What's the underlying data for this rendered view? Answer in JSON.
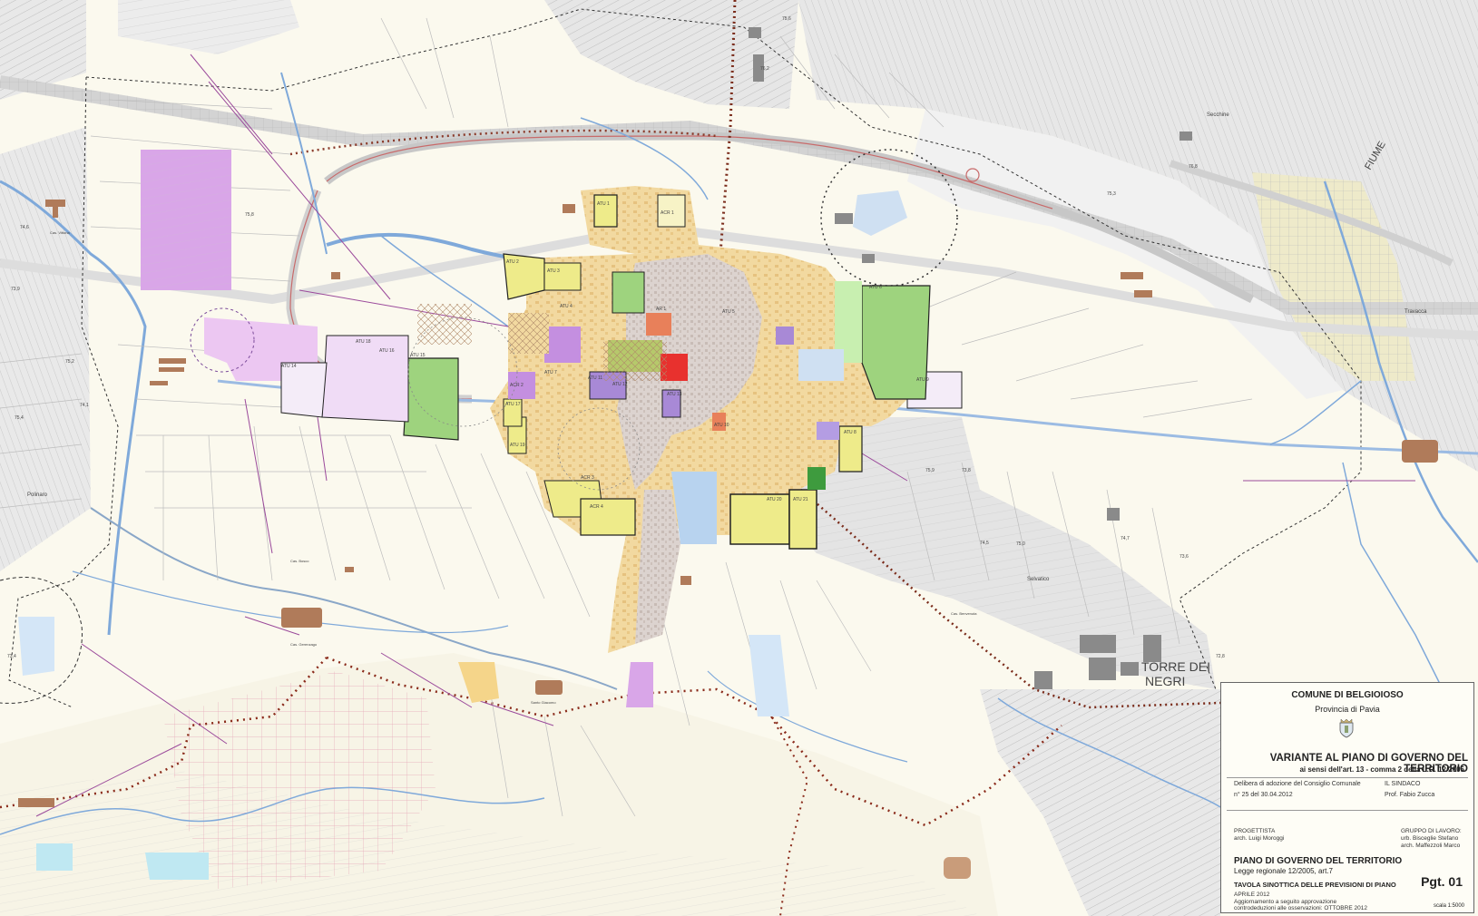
{
  "map": {
    "place_labels": [
      "TORRE DEI",
      "NEGRI",
      "FIUME",
      "Travacca",
      "Secchine",
      "Polinaro",
      "Selvatico",
      "Cas. Vittoria",
      "Cas. Gerenzago",
      "Cas. Bosco",
      "Cas. Benvenuta",
      "Santo Giacomo"
    ],
    "zone_labels": [
      "ATU 1",
      "ATU 2",
      "ATU 3",
      "ATU 4",
      "ATU 5",
      "ATU 6",
      "ATU 7",
      "ATU 8",
      "ATU 9",
      "ATU 10",
      "ATU 11",
      "ATU 12",
      "ATU 13",
      "ATU 14",
      "ATU 15",
      "ATU 16",
      "ATU 17",
      "ATU 18",
      "ATU 19",
      "ATU 20",
      "ATU 21",
      "ACR 1",
      "ACR 2",
      "ACR 3",
      "ACR 4",
      "AR 1"
    ],
    "spot_heights": [
      "75,8",
      "74,6",
      "75,2",
      "73,9",
      "74,1",
      "75,4",
      "73,4",
      "75,6",
      "76,2",
      "75,9",
      "73,8",
      "74,5",
      "73,6",
      "75,0",
      "72,8",
      "74,7",
      "76,8",
      "75,3"
    ],
    "colors": {
      "background": "#fbf9ee",
      "urban_residential": "#f2d9a0",
      "historic_centre": "#dcd3cf",
      "transformation_area": "#eeeb8a",
      "public_green": "#9ed37e",
      "services": "#d9a6e8",
      "industrial": "#c9b9ef",
      "water": "#7fa9da",
      "railway": "#7a2b1a",
      "agricultural_hatched": "#d6d6d6"
    }
  },
  "cartouche": {
    "municipality": "COMUNE DI BELGIOIOSO",
    "province": "Provincia di Pavia",
    "title": "VARIANTE AL PIANO DI GOVERNO DEL TERRITORIO",
    "subtitle": "ai sensi dell'art. 13 - comma 2 della L.R. 12/2005",
    "adoption_label": "Delibera di adozione del Consiglio Comunale",
    "adoption_ref": "n° 25 del 30.04.2012",
    "mayor_label": "IL SINDACO",
    "mayor_name": "Prof. Fabio Zucca",
    "designer_label": "PROGETTISTA",
    "designer_name": "arch. Luigi Moroggi",
    "workgroup_label": "GRUPPO DI LAVORO:",
    "workgroup_1": "urb. Bisceglie Stefano",
    "workgroup_2": "arch. Maffezzoli Marco",
    "plan_title": "PIANO DI GOVERNO DEL TERRITORIO",
    "law": "Legge regionale 12/2005, art.7",
    "sheet_title": "TAVOLA SINOTTICA DELLE PREVISIONI DI PIANO",
    "sheet_code": "Pgt. 01",
    "date_1": "APRILE 2012",
    "date_2": "Aggiornamento a seguito approvazione",
    "date_3": "controdeduzioni alle osservazioni: OTTOBRE 2012",
    "scale": "scala 1:5000"
  }
}
